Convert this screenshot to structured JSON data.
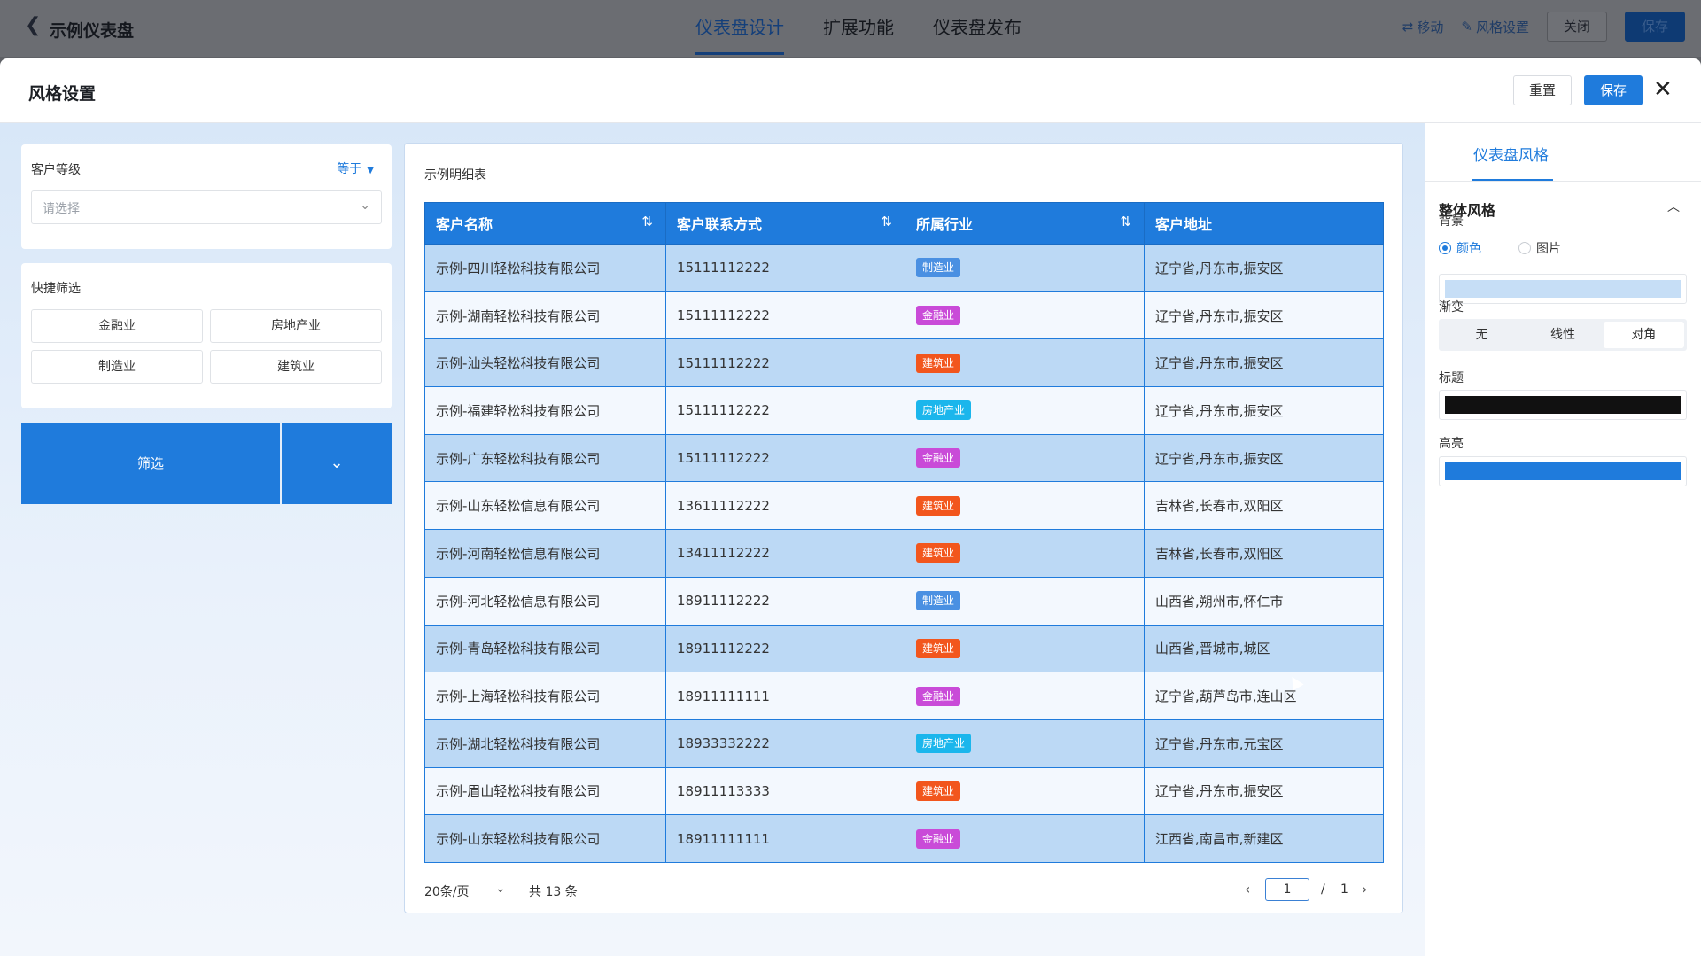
{
  "topbar": {
    "title": "示例仪表盘",
    "tabs": [
      "仪表盘设计",
      "扩展功能",
      "仪表盘发布"
    ],
    "move_label": "移动",
    "style_label": "风格设置",
    "close_label": "关闭",
    "save_label": "保存"
  },
  "drawer": {
    "title": "风格设置",
    "reset_label": "重置",
    "save_label": "保存",
    "close_symbol": "✕"
  },
  "filter_level": {
    "label": "客户等级",
    "operator": "等于",
    "placeholder": "请选择"
  },
  "quick_filter": {
    "label": "快捷筛选",
    "options": [
      "金融业",
      "房地产业",
      "制造业",
      "建筑业"
    ]
  },
  "filter_button": {
    "label": "筛选"
  },
  "table": {
    "title": "示例明细表",
    "columns": [
      "客户名称",
      "客户联系方式",
      "所属行业",
      "客户地址"
    ],
    "rows": [
      {
        "name": "示例-四川轻松科技有限公司",
        "phone": "15111112222",
        "industry": "制造业",
        "address": "辽宁省,丹东市,振安区"
      },
      {
        "name": "示例-湖南轻松科技有限公司",
        "phone": "15111112222",
        "industry": "金融业",
        "address": "辽宁省,丹东市,振安区"
      },
      {
        "name": "示例-汕头轻松科技有限公司",
        "phone": "15111112222",
        "industry": "建筑业",
        "address": "辽宁省,丹东市,振安区"
      },
      {
        "name": "示例-福建轻松科技有限公司",
        "phone": "15111112222",
        "industry": "房地产业",
        "address": "辽宁省,丹东市,振安区"
      },
      {
        "name": "示例-广东轻松科技有限公司",
        "phone": "15111112222",
        "industry": "金融业",
        "address": "辽宁省,丹东市,振安区"
      },
      {
        "name": "示例-山东轻松信息有限公司",
        "phone": "13611112222",
        "industry": "建筑业",
        "address": "吉林省,长春市,双阳区"
      },
      {
        "name": "示例-河南轻松信息有限公司",
        "phone": "13411112222",
        "industry": "建筑业",
        "address": "吉林省,长春市,双阳区"
      },
      {
        "name": "示例-河北轻松信息有限公司",
        "phone": "18911112222",
        "industry": "制造业",
        "address": "山西省,朔州市,怀仁市"
      },
      {
        "name": "示例-青岛轻松科技有限公司",
        "phone": "18911112222",
        "industry": "建筑业",
        "address": "山西省,晋城市,城区"
      },
      {
        "name": "示例-上海轻松科技有限公司",
        "phone": "18911111111",
        "industry": "金融业",
        "address": "辽宁省,葫芦岛市,连山区"
      },
      {
        "name": "示例-湖北轻松科技有限公司",
        "phone": "18933332222",
        "industry": "房地产业",
        "address": "辽宁省,丹东市,元宝区"
      },
      {
        "name": "示例-眉山轻松科技有限公司",
        "phone": "18911113333",
        "industry": "建筑业",
        "address": "辽宁省,丹东市,振安区"
      },
      {
        "name": "示例-山东轻松科技有限公司",
        "phone": "18911111111",
        "industry": "金融业",
        "address": "江西省,南昌市,新建区"
      }
    ],
    "tag_colors": {
      "制造业": "#4a90e2",
      "金融业": "#c94bd8",
      "建筑业": "#f2561d",
      "房地产业": "#1bb6ec"
    }
  },
  "pager": {
    "page_size": "20条/页",
    "total": "共 13 条",
    "current_page": "1",
    "slash": "/",
    "total_pages": "1"
  },
  "style_panel": {
    "tab": "仪表盘风格",
    "section": "整体风格",
    "background_label": "背景",
    "bg_options": [
      "颜色",
      "图片"
    ],
    "bg_selected": "颜色",
    "gradient_label": "渐变",
    "gradient_options": [
      "无",
      "线性",
      "对角"
    ],
    "gradient_selected": "对角",
    "title_label": "标题",
    "highlight_label": "高亮",
    "colors": {
      "background": "#c6def6",
      "title": "#111111",
      "highlight": "#1f7bdc"
    }
  }
}
